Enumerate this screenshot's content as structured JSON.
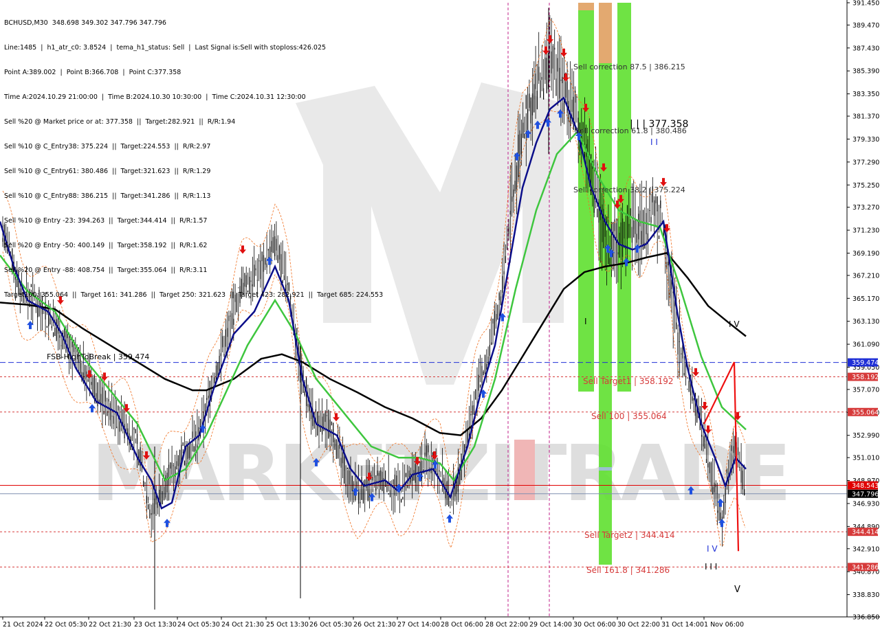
{
  "header": {
    "lines": [
      "BCHUSD,M30  348.698 349.302 347.796 347.796",
      "Line:1485  |  h1_atr_c0: 3.8524  |  tema_h1_status: Sell  |  Last Signal is:Sell with stoploss:426.025",
      "Point A:389.002  |  Point B:366.708  |  Point C:377.358",
      "Time A:2024.10.29 21:00:00  |  Time B:2024.10.30 10:30:00  |  Time C:2024.10.31 12:30:00",
      "Sell %20 @ Market price or at: 377.358  ||  Target:282.921  ||  R/R:1.94",
      "Sell %10 @ C_Entry38: 375.224  ||  Target:224.553  ||  R/R:2.97",
      "Sell %10 @ C_Entry61: 380.486  ||  Target:321.623  ||  R/R:1.29",
      "Sell %10 @ C_Entry88: 386.215  ||  Target:341.286  ||  R/R:1.13",
      "Sell %10 @ Entry -23: 394.263  ||  Target:344.414  ||  R/R:1.57",
      "Sell %20 @ Entry -50: 400.149  ||  Target:358.192  ||  R/R:1.62",
      "Sell %20 @ Entry -88: 408.754  ||  Target:355.064  ||  R/R:3.11",
      "Target100: 355.064  ||  Target 161: 341.286  ||  Target 250: 321.623  ||  Target 423: 282.921  ||  Target 685: 224.553"
    ]
  },
  "chart_data": {
    "type": "candlestick",
    "symbol": "BCHUSD",
    "timeframe": "M30",
    "ylim": [
      336.85,
      391.45
    ],
    "y_ticks": [
      "391.450",
      "389.470",
      "387.430",
      "385.390",
      "383.350",
      "381.370",
      "379.330",
      "377.290",
      "375.250",
      "373.270",
      "371.230",
      "369.190",
      "367.210",
      "365.170",
      "363.130",
      "361.090",
      "359.050",
      "357.070",
      "355.030",
      "352.990",
      "351.010",
      "348.970",
      "346.930",
      "344.890",
      "342.910",
      "340.870",
      "338.830",
      "336.850"
    ],
    "x_ticks": [
      "21 Oct 2024",
      "22 Oct 05:30",
      "22 Oct 21:30",
      "23 Oct 13:30",
      "24 Oct 05:30",
      "24 Oct 21:30",
      "25 Oct 13:30",
      "26 Oct 05:30",
      "26 Oct 21:30",
      "27 Oct 14:00",
      "28 Oct 06:00",
      "28 Oct 22:00",
      "29 Oct 14:00",
      "30 Oct 06:00",
      "30 Oct 22:00",
      "31 Oct 14:00",
      "1 Nov 06:00"
    ],
    "price_tags": [
      {
        "label": "359.474",
        "value": 359.474,
        "color": "#1f2fd6"
      },
      {
        "label": "358.192",
        "value": 358.192,
        "color": "#d63a3a"
      },
      {
        "label": "355.064",
        "value": 355.064,
        "color": "#d63a3a"
      },
      {
        "label": "348.543",
        "value": 348.543,
        "color": "#e00000"
      },
      {
        "label": "347.796",
        "value": 347.796,
        "color": "#000000"
      },
      {
        "label": "344.414",
        "value": 344.414,
        "color": "#d63a3a"
      },
      {
        "label": "341.286",
        "value": 341.286,
        "color": "#d63a3a"
      }
    ],
    "annotations": [
      {
        "text": "FSB-HighToBreak  |  359.474",
        "color": "#000000"
      },
      {
        "text": "Sell correction 87.5 | 386.215",
        "color": "#333333"
      },
      {
        "text": "Sell correction 61.8 | 380.486",
        "color": "#333333"
      },
      {
        "text": "Sell correction 38.2 | 375.224",
        "color": "#333333"
      },
      {
        "text": "| | | 377.358",
        "color": "#000000"
      },
      {
        "text": "Sell Target1 | 358.192",
        "color": "#d63a3a"
      },
      {
        "text": "Sell 100 | 355.064",
        "color": "#d63a3a"
      },
      {
        "text": "Sell Target2 | 344.414",
        "color": "#d63a3a"
      },
      {
        "text": "Sell 161.8 | 341.286",
        "color": "#d63a3a"
      },
      {
        "text": "I V",
        "color": "#1f2fd6"
      },
      {
        "text": "I I I",
        "color": "#000000"
      },
      {
        "text": "V",
        "color": "#000000"
      },
      {
        "text": "I V",
        "color": "#000000"
      },
      {
        "text": "I I",
        "color": "#1f2fd6"
      },
      {
        "text": "I",
        "color": "#000000"
      }
    ],
    "watermark": "MARKETZITRADE",
    "colors": {
      "candle": "#000000",
      "tema": "#0b0e8a",
      "ema_green": "#3ec63e",
      "ma_black": "#000000",
      "envelope": "#f07020",
      "buy_arrow": "#1f50e0",
      "sell_arrow": "#e01010",
      "zone_green": "#5fe030",
      "zone_orange": "#e0a060"
    }
  }
}
